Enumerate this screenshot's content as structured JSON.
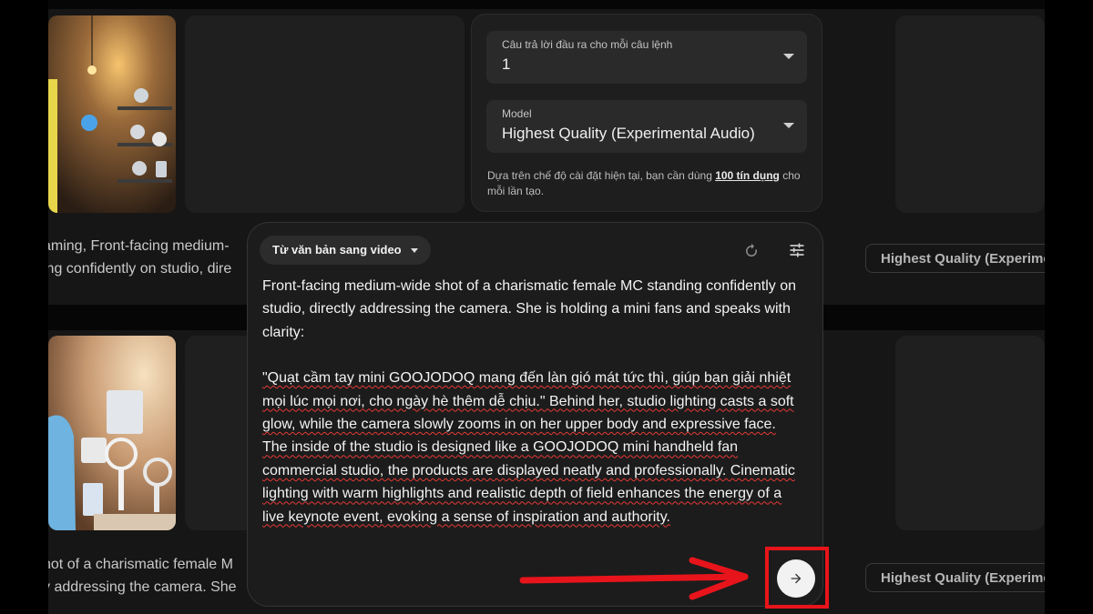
{
  "background": {
    "row1_caption": [
      "aming, Front-facing medium-",
      "ing confidently on studio, dire"
    ],
    "row2_caption": [
      "hot of a charismatic female M",
      "y addressing the camera. She"
    ],
    "row1_chip": "Highest Quality (Experime",
    "row2_chip": "Highest Quality (Experime"
  },
  "settings": {
    "outputs": {
      "label": "Câu trả lời đầu ra cho mỗi câu lệnh",
      "value": "1"
    },
    "model": {
      "label": "Model",
      "value": "Highest Quality (Experimental Audio)"
    },
    "note_prefix": "Dựa trên chế độ cài đặt hiện tại, bạn cần dùng ",
    "note_credits": "100 tín dụng",
    "note_suffix": " cho mỗi lần tạo."
  },
  "composer": {
    "mode_label": "Từ văn bản sang video",
    "p1": "Front-facing medium-wide shot of a charismatic female MC standing confidently on studio, directly addressing the camera. She is holding a mini fans and speaks with clarity:",
    "p2": "\"Quạt cầm tay mini GOOJODOQ mang đến làn gió mát tức thì, giúp bạn giải nhiệt mọi lúc mọi nơi, cho ngày hè thêm dễ chịu.\" Behind her, studio lighting casts a soft glow, while the camera slowly zooms in on her upper body and expressive face. The inside of the studio is designed like a GOOJODOQ mini handheld fan commercial studio, the products are displayed neatly and professionally. Cinematic lighting with warm highlights and realistic depth of field enhances the energy of a live keynote event, evoking a sense of inspiration and authority."
  },
  "icons": {
    "reset": "refresh-icon",
    "settings": "tune-icon",
    "send": "arrow-right-icon",
    "dropdown": "caret-down-icon"
  },
  "colors": {
    "annotation_red": "#e8141b",
    "squiggle": "#e53935",
    "panel": "#1e1e1e"
  }
}
